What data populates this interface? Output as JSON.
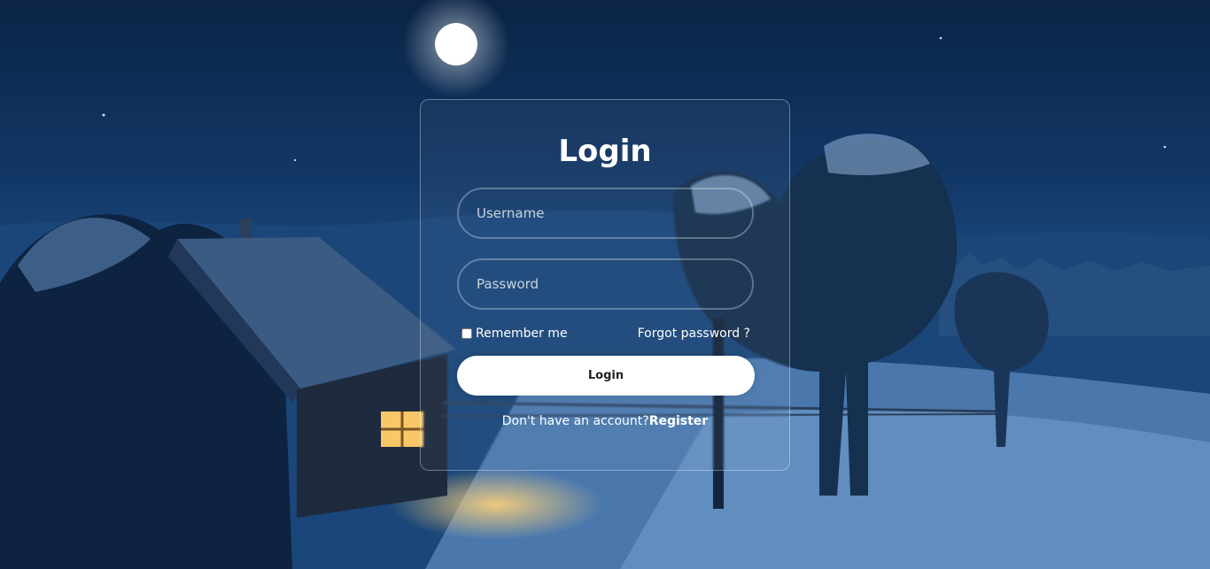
{
  "login": {
    "title": "Login",
    "username_placeholder": "Username",
    "password_placeholder": "Password",
    "remember_label": "Remember me",
    "forgot_label": "Forgot password ?",
    "submit_label": "Login",
    "register_prompt": "Don't have an account?",
    "register_label": "Register"
  },
  "colors": {
    "sky_top": "#0b2446",
    "sky_mid": "#1d4f86",
    "ground": "#3f6ea0",
    "moon": "#ffffff",
    "window_glow": "#f7c768",
    "card_border": "rgba(255,255,255,0.35)",
    "button_bg": "#ffffff"
  },
  "icons": {
    "remember_checkbox": "checkbox"
  }
}
